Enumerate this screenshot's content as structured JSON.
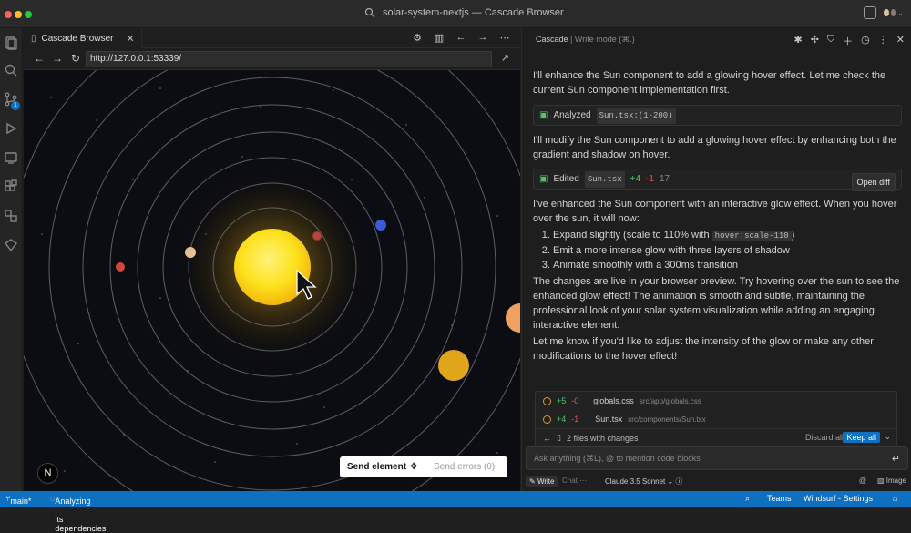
{
  "window": {
    "title": "solar-system-nextjs — Cascade Browser"
  },
  "browser": {
    "tab_label": "Cascade Browser",
    "tab_close": "✕",
    "url": "http://127.0.0.1:53339/",
    "send_element": "Send element",
    "send_errors": "Send errors (0)",
    "next_logo": "N"
  },
  "cascade": {
    "header_title": "Cascade",
    "header_mode": "| Write mode (⌘.)",
    "intro": "I'll enhance the Sun component to add a glowing hover effect. Let me check the current Sun component implementation first.",
    "analyzed_label": "Analyzed",
    "analyzed_file": "Sun.tsx:(1-200)",
    "modify_text": "I'll modify the Sun component to add a glowing hover effect by enhancing both the gradient and shadow on hover.",
    "edited_label": "Edited",
    "edited_file": "Sun.tsx",
    "edited_add": "+4",
    "edited_del": "-1",
    "edited_lines": "17",
    "open_diff": "Open diff",
    "summary": "I've enhanced the Sun component with an interactive glow effect. When you hover over the sun, it will now:",
    "list": [
      {
        "pre": "Expand slightly (scale to 110% with ",
        "code": "hover:scale-110",
        "post": ")"
      },
      {
        "pre": "Emit a more intense glow with three layers of shadow",
        "code": "",
        "post": ""
      },
      {
        "pre": "Animate smoothly with a 300ms transition",
        "code": "",
        "post": ""
      }
    ],
    "live_text": "The changes are live in your browser preview. Try hovering over the sun to see the enhanced glow effect! The animation is smooth and subtle, maintaining the professional look of your solar system visualization while adding an engaging interactive element.",
    "followup": "Let me know if you'd like to adjust the intensity of the glow or make any other modifications to the hover effect!",
    "changes": [
      {
        "add": "+5",
        "del": "-0",
        "file": "globals.css",
        "path": "src/app/globals.css"
      },
      {
        "add": "+4",
        "del": "-1",
        "file": "Sun.tsx",
        "path": "src/components/Sun.tsx"
      }
    ],
    "files_changed": "2 files with changes",
    "discard_all": "Discard all",
    "keep_all": "Keep all",
    "ask_placeholder": "Ask anything (⌘L), @ to mention code blocks",
    "write": "Write",
    "chat": "Chat",
    "model": "Claude 3.5 Sonnet",
    "image": "Image"
  },
  "status": {
    "branch": "main*",
    "analyzing": "Analyzing 'Sun.tsx' and its dependencies",
    "teams": "Teams",
    "windsurf": "Windsurf - Settings"
  },
  "colors": {
    "accent": "#0e70c0",
    "sun": "#f5c518",
    "added": "#4ec76a",
    "removed": "#f0555a"
  }
}
